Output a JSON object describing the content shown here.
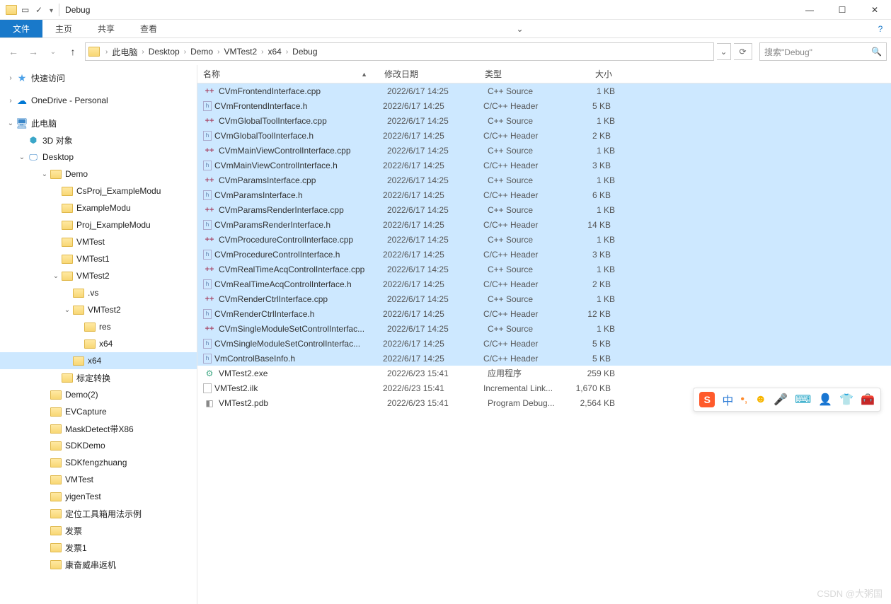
{
  "window": {
    "title": "Debug"
  },
  "ribbon": {
    "file": "文件",
    "home": "主页",
    "share": "共享",
    "view": "查看"
  },
  "breadcrumbs": [
    "此电脑",
    "Desktop",
    "Demo",
    "VMTest2",
    "x64",
    "Debug"
  ],
  "search": {
    "placeholder": "搜索\"Debug\""
  },
  "nav": {
    "quick": "快速访问",
    "onedrive": "OneDrive - Personal",
    "pc": "此电脑",
    "threeD": "3D 对象",
    "desktop": "Desktop",
    "tree": [
      {
        "l": "Demo",
        "d": 3,
        "exp": true
      },
      {
        "l": "CsProj_ExampleModu",
        "d": 4
      },
      {
        "l": "ExampleModu",
        "d": 4
      },
      {
        "l": "Proj_ExampleModu",
        "d": 4
      },
      {
        "l": "VMTest",
        "d": 4
      },
      {
        "l": "VMTest1",
        "d": 4
      },
      {
        "l": "VMTest2",
        "d": 4,
        "exp": true
      },
      {
        "l": ".vs",
        "d": 5
      },
      {
        "l": "VMTest2",
        "d": 5,
        "exp": true
      },
      {
        "l": "res",
        "d": 6
      },
      {
        "l": "x64",
        "d": 6
      },
      {
        "l": "x64",
        "d": 5,
        "sel": true
      },
      {
        "l": "标定转换",
        "d": 4
      },
      {
        "l": "Demo(2)",
        "d": 3
      },
      {
        "l": "EVCapture",
        "d": 3
      },
      {
        "l": "MaskDetect带X86",
        "d": 3
      },
      {
        "l": "SDKDemo",
        "d": 3
      },
      {
        "l": "SDKfengzhuang",
        "d": 3
      },
      {
        "l": "VMTest",
        "d": 3
      },
      {
        "l": "yigenTest",
        "d": 3
      },
      {
        "l": "定位工具箱用法示例",
        "d": 3
      },
      {
        "l": "发票",
        "d": 3
      },
      {
        "l": "发票1",
        "d": 3
      },
      {
        "l": "康奋威串返机",
        "d": 3
      }
    ]
  },
  "columns": {
    "name": "名称",
    "date": "修改日期",
    "type": "类型",
    "size": "大小"
  },
  "files": [
    {
      "n": "CVmFrontendInterface.cpp",
      "d": "2022/6/17 14:25",
      "t": "C++ Source",
      "s": "1 KB",
      "k": "cpp",
      "sel": true
    },
    {
      "n": "CVmFrontendInterface.h",
      "d": "2022/6/17 14:25",
      "t": "C/C++ Header",
      "s": "5 KB",
      "k": "h",
      "sel": true
    },
    {
      "n": "CVmGlobalToolInterface.cpp",
      "d": "2022/6/17 14:25",
      "t": "C++ Source",
      "s": "1 KB",
      "k": "cpp",
      "sel": true
    },
    {
      "n": "CVmGlobalToolInterface.h",
      "d": "2022/6/17 14:25",
      "t": "C/C++ Header",
      "s": "2 KB",
      "k": "h",
      "sel": true
    },
    {
      "n": "CVmMainViewControlInterface.cpp",
      "d": "2022/6/17 14:25",
      "t": "C++ Source",
      "s": "1 KB",
      "k": "cpp",
      "sel": true
    },
    {
      "n": "CVmMainViewControlInterface.h",
      "d": "2022/6/17 14:25",
      "t": "C/C++ Header",
      "s": "3 KB",
      "k": "h",
      "sel": true
    },
    {
      "n": "CVmParamsInterface.cpp",
      "d": "2022/6/17 14:25",
      "t": "C++ Source",
      "s": "1 KB",
      "k": "cpp",
      "sel": true
    },
    {
      "n": "CVmParamsInterface.h",
      "d": "2022/6/17 14:25",
      "t": "C/C++ Header",
      "s": "6 KB",
      "k": "h",
      "sel": true
    },
    {
      "n": "CVmParamsRenderInterface.cpp",
      "d": "2022/6/17 14:25",
      "t": "C++ Source",
      "s": "1 KB",
      "k": "cpp",
      "sel": true
    },
    {
      "n": "CVmParamsRenderInterface.h",
      "d": "2022/6/17 14:25",
      "t": "C/C++ Header",
      "s": "14 KB",
      "k": "h",
      "sel": true
    },
    {
      "n": "CVmProcedureControlInterface.cpp",
      "d": "2022/6/17 14:25",
      "t": "C++ Source",
      "s": "1 KB",
      "k": "cpp",
      "sel": true
    },
    {
      "n": "CVmProcedureControlInterface.h",
      "d": "2022/6/17 14:25",
      "t": "C/C++ Header",
      "s": "3 KB",
      "k": "h",
      "sel": true
    },
    {
      "n": "CVmRealTimeAcqControlInterface.cpp",
      "d": "2022/6/17 14:25",
      "t": "C++ Source",
      "s": "1 KB",
      "k": "cpp",
      "sel": true
    },
    {
      "n": "CVmRealTimeAcqControlInterface.h",
      "d": "2022/6/17 14:25",
      "t": "C/C++ Header",
      "s": "2 KB",
      "k": "h",
      "sel": true
    },
    {
      "n": "CVmRenderCtrlInterface.cpp",
      "d": "2022/6/17 14:25",
      "t": "C++ Source",
      "s": "1 KB",
      "k": "cpp",
      "sel": true
    },
    {
      "n": "CVmRenderCtrlInterface.h",
      "d": "2022/6/17 14:25",
      "t": "C/C++ Header",
      "s": "12 KB",
      "k": "h",
      "sel": true
    },
    {
      "n": "CVmSingleModuleSetControlInterfac...",
      "d": "2022/6/17 14:25",
      "t": "C++ Source",
      "s": "1 KB",
      "k": "cpp",
      "sel": true
    },
    {
      "n": "CVmSingleModuleSetControlInterfac...",
      "d": "2022/6/17 14:25",
      "t": "C/C++ Header",
      "s": "5 KB",
      "k": "h",
      "sel": true
    },
    {
      "n": "VmControlBaseInfo.h",
      "d": "2022/6/17 14:25",
      "t": "C/C++ Header",
      "s": "5 KB",
      "k": "h",
      "sel": true
    },
    {
      "n": "VMTest2.exe",
      "d": "2022/6/23 15:41",
      "t": "应用程序",
      "s": "259 KB",
      "k": "exe",
      "sel": false
    },
    {
      "n": "VMTest2.ilk",
      "d": "2022/6/23 15:41",
      "t": "Incremental Link...",
      "s": "1,670 KB",
      "k": "ilk",
      "sel": false
    },
    {
      "n": "VMTest2.pdb",
      "d": "2022/6/23 15:41",
      "t": "Program Debug...",
      "s": "2,564 KB",
      "k": "pdb",
      "sel": false
    }
  ],
  "ime": {
    "logo": "S",
    "lang": "中"
  },
  "watermark": "CSDN @大粥国"
}
